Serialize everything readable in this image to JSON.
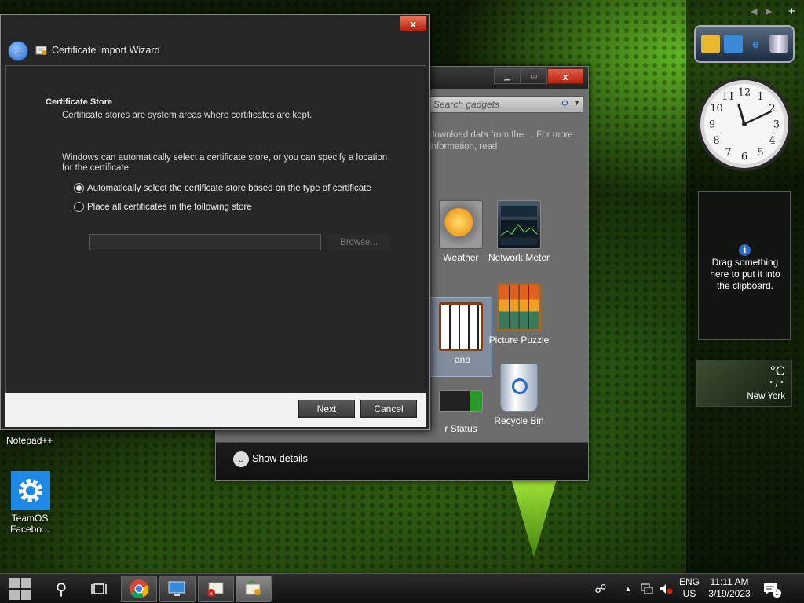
{
  "wizard": {
    "title": "Certificate Import Wizard",
    "close_label": "x",
    "heading": "Certificate Store",
    "description": "Certificate stores are system areas where certificates are kept.",
    "instruction": "Windows can automatically select a certificate store, or you can specify a location for the certificate.",
    "option_auto": "Automatically select the certificate store based on the type of certificate",
    "option_manual": "Place all certificates in the following store",
    "selected_option": "auto",
    "store_value": "",
    "browse_label": "Browse...",
    "next_label": "Next",
    "cancel_label": "Cancel"
  },
  "gallery": {
    "search_placeholder": "Search gadgets",
    "info_text": "download data from the ... For more information, read",
    "close_label": "x",
    "gadgets": [
      {
        "label": "Weather",
        "icon": "weather-icon"
      },
      {
        "label": "Network Meter",
        "icon": "network-meter-icon"
      },
      {
        "label": "ano",
        "icon": "piano-icon"
      },
      {
        "label": "Picture Puzzle",
        "icon": "picture-puzzle-icon"
      },
      {
        "label": "r Status",
        "icon": "battery-status-icon"
      },
      {
        "label": "Recycle Bin",
        "icon": "recycle-bin-icon"
      }
    ],
    "show_details_label": "Show details"
  },
  "desktop": {
    "notepad_label": "Notepad++",
    "teamos_label_line1": "TeamOS",
    "teamos_label_line2": "Facebo..."
  },
  "sidebar": {
    "clipboard_text": "Drag something here to put it into the clipboard.",
    "weather_unit": "°C",
    "weather_hilo": "° / °",
    "weather_city": "New York",
    "clock_numbers": [
      "12",
      "1",
      "2",
      "3",
      "4",
      "5",
      "6",
      "7",
      "8",
      "9",
      "10",
      "11"
    ]
  },
  "taskbar": {
    "lang_top": "ENG",
    "lang_bottom": "US",
    "time": "11:11 AM",
    "date": "3/19/2023",
    "notifications": "1"
  },
  "colors": {
    "accent_green": "#6ccf2a",
    "close_red": "#c8321a",
    "link_blue": "#2a68c8"
  }
}
